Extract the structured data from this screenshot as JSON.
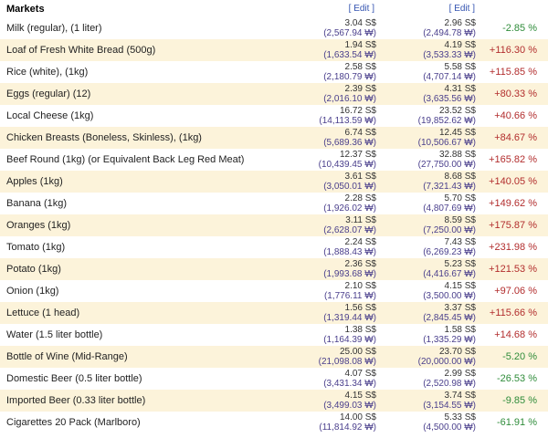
{
  "section": {
    "title": "Markets",
    "edit_label_1": "[ Edit ]",
    "edit_label_2": "[ Edit ]"
  },
  "colors": {
    "alt_row": "#fcf3da",
    "positive": "#b22d2d",
    "negative": "#2f8c3a",
    "krw": "#4a3f8c",
    "link": "#3353b0"
  },
  "rows": [
    {
      "name": "Milk (regular), (1 liter)",
      "p1_sgd": "3.04 S$",
      "p1_krw": "(2,567.94 ₩)",
      "p2_sgd": "2.96 S$",
      "p2_krw": "(2,494.78 ₩)",
      "diff": "-2.85 %",
      "sign": "neg"
    },
    {
      "name": "Loaf of Fresh White Bread (500g)",
      "p1_sgd": "1.94 S$",
      "p1_krw": "(1,633.54 ₩)",
      "p2_sgd": "4.19 S$",
      "p2_krw": "(3,533.33 ₩)",
      "diff": "+116.30 %",
      "sign": "pos"
    },
    {
      "name": "Rice (white), (1kg)",
      "p1_sgd": "2.58 S$",
      "p1_krw": "(2,180.79 ₩)",
      "p2_sgd": "5.58 S$",
      "p2_krw": "(4,707.14 ₩)",
      "diff": "+115.85 %",
      "sign": "pos"
    },
    {
      "name": "Eggs (regular) (12)",
      "p1_sgd": "2.39 S$",
      "p1_krw": "(2,016.10 ₩)",
      "p2_sgd": "4.31 S$",
      "p2_krw": "(3,635.56 ₩)",
      "diff": "+80.33 %",
      "sign": "pos"
    },
    {
      "name": "Local Cheese (1kg)",
      "p1_sgd": "16.72 S$",
      "p1_krw": "(14,113.59 ₩)",
      "p2_sgd": "23.52 S$",
      "p2_krw": "(19,852.62 ₩)",
      "diff": "+40.66 %",
      "sign": "pos"
    },
    {
      "name": "Chicken Breasts (Boneless, Skinless), (1kg)",
      "p1_sgd": "6.74 S$",
      "p1_krw": "(5,689.36 ₩)",
      "p2_sgd": "12.45 S$",
      "p2_krw": "(10,506.67 ₩)",
      "diff": "+84.67 %",
      "sign": "pos"
    },
    {
      "name": "Beef Round (1kg) (or Equivalent Back Leg Red Meat)",
      "p1_sgd": "12.37 S$",
      "p1_krw": "(10,439.45 ₩)",
      "p2_sgd": "32.88 S$",
      "p2_krw": "(27,750.00 ₩)",
      "diff": "+165.82 %",
      "sign": "pos"
    },
    {
      "name": "Apples (1kg)",
      "p1_sgd": "3.61 S$",
      "p1_krw": "(3,050.01 ₩)",
      "p2_sgd": "8.68 S$",
      "p2_krw": "(7,321.43 ₩)",
      "diff": "+140.05 %",
      "sign": "pos"
    },
    {
      "name": "Banana (1kg)",
      "p1_sgd": "2.28 S$",
      "p1_krw": "(1,926.02 ₩)",
      "p2_sgd": "5.70 S$",
      "p2_krw": "(4,807.69 ₩)",
      "diff": "+149.62 %",
      "sign": "pos"
    },
    {
      "name": "Oranges (1kg)",
      "p1_sgd": "3.11 S$",
      "p1_krw": "(2,628.07 ₩)",
      "p2_sgd": "8.59 S$",
      "p2_krw": "(7,250.00 ₩)",
      "diff": "+175.87 %",
      "sign": "pos"
    },
    {
      "name": "Tomato (1kg)",
      "p1_sgd": "2.24 S$",
      "p1_krw": "(1,888.43 ₩)",
      "p2_sgd": "7.43 S$",
      "p2_krw": "(6,269.23 ₩)",
      "diff": "+231.98 %",
      "sign": "pos"
    },
    {
      "name": "Potato (1kg)",
      "p1_sgd": "2.36 S$",
      "p1_krw": "(1,993.68 ₩)",
      "p2_sgd": "5.23 S$",
      "p2_krw": "(4,416.67 ₩)",
      "diff": "+121.53 %",
      "sign": "pos"
    },
    {
      "name": "Onion (1kg)",
      "p1_sgd": "2.10 S$",
      "p1_krw": "(1,776.11 ₩)",
      "p2_sgd": "4.15 S$",
      "p2_krw": "(3,500.00 ₩)",
      "diff": "+97.06 %",
      "sign": "pos"
    },
    {
      "name": "Lettuce (1 head)",
      "p1_sgd": "1.56 S$",
      "p1_krw": "(1,319.44 ₩)",
      "p2_sgd": "3.37 S$",
      "p2_krw": "(2,845.45 ₩)",
      "diff": "+115.66 %",
      "sign": "pos"
    },
    {
      "name": "Water (1.5 liter bottle)",
      "p1_sgd": "1.38 S$",
      "p1_krw": "(1,164.39 ₩)",
      "p2_sgd": "1.58 S$",
      "p2_krw": "(1,335.29 ₩)",
      "diff": "+14.68 %",
      "sign": "pos"
    },
    {
      "name": "Bottle of Wine (Mid-Range)",
      "p1_sgd": "25.00 S$",
      "p1_krw": "(21,098.08 ₩)",
      "p2_sgd": "23.70 S$",
      "p2_krw": "(20,000.00 ₩)",
      "diff": "-5.20 %",
      "sign": "neg"
    },
    {
      "name": "Domestic Beer (0.5 liter bottle)",
      "p1_sgd": "4.07 S$",
      "p1_krw": "(3,431.34 ₩)",
      "p2_sgd": "2.99 S$",
      "p2_krw": "(2,520.98 ₩)",
      "diff": "-26.53 %",
      "sign": "neg"
    },
    {
      "name": "Imported Beer (0.33 liter bottle)",
      "p1_sgd": "4.15 S$",
      "p1_krw": "(3,499.03 ₩)",
      "p2_sgd": "3.74 S$",
      "p2_krw": "(3,154.55 ₩)",
      "diff": "-9.85 %",
      "sign": "neg"
    },
    {
      "name": "Cigarettes 20 Pack (Marlboro)",
      "p1_sgd": "14.00 S$",
      "p1_krw": "(11,814.92 ₩)",
      "p2_sgd": "5.33 S$",
      "p2_krw": "(4,500.00 ₩)",
      "diff": "-61.91 %",
      "sign": "neg"
    }
  ]
}
